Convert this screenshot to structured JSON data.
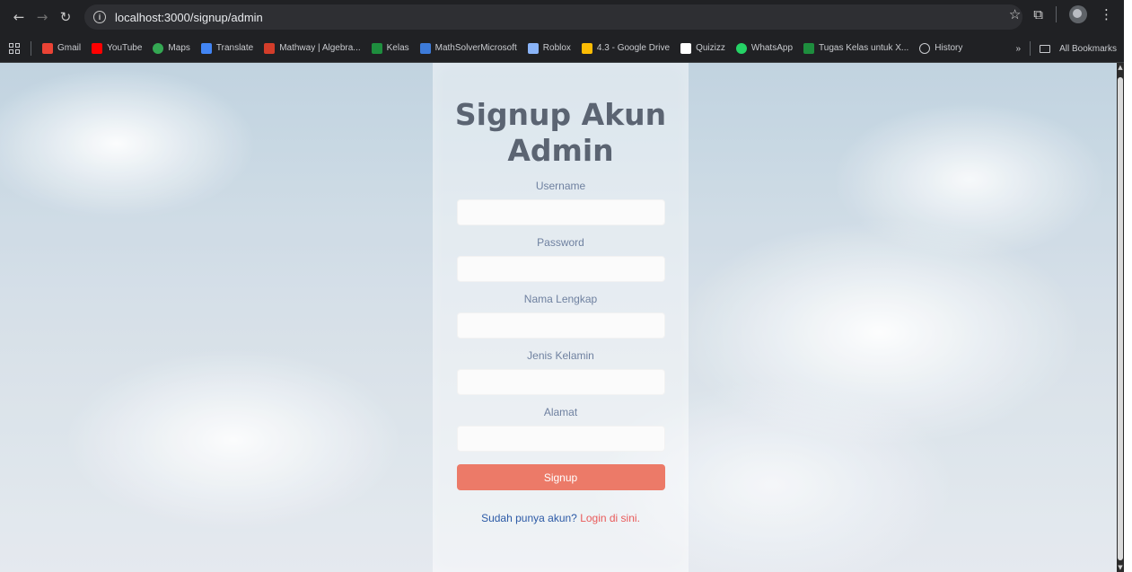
{
  "browser": {
    "url": "localhost:3000/signup/admin",
    "bookmarks": [
      {
        "label": "Gmail",
        "icon": "gmail-icon",
        "color": "#ea4335"
      },
      {
        "label": "YouTube",
        "icon": "youtube-icon",
        "color": "#ff0000"
      },
      {
        "label": "Maps",
        "icon": "maps-icon",
        "color": "#34a853"
      },
      {
        "label": "Translate",
        "icon": "translate-icon",
        "color": "#4285f4"
      },
      {
        "label": "Mathway | Algebra...",
        "icon": "mathway-icon",
        "color": "#d33d2a"
      },
      {
        "label": "Kelas",
        "icon": "kelas-icon",
        "color": "#1e8e3e"
      },
      {
        "label": "MathSolverMicrosoft",
        "icon": "math-solver-icon",
        "color": "#3d7bd9"
      },
      {
        "label": "Roblox",
        "icon": "roblox-icon",
        "color": "#8ab4f8"
      },
      {
        "label": "4.3 - Google Drive",
        "icon": "drive-icon",
        "color": "#fbbc04"
      },
      {
        "label": "Quizizz",
        "icon": "quizizz-icon",
        "color": "#ffffff"
      },
      {
        "label": "WhatsApp",
        "icon": "whatsapp-icon",
        "color": "#25d366"
      },
      {
        "label": "Tugas Kelas untuk X...",
        "icon": "classroom-icon",
        "color": "#1e8e3e"
      },
      {
        "label": "History",
        "icon": "history-icon",
        "color": "#c9cbcf"
      }
    ],
    "more_label": "»",
    "all_bookmarks": "All Bookmarks"
  },
  "page": {
    "title_line1": "Signup Akun",
    "title_line2": "Admin",
    "fields": [
      {
        "label": "Username"
      },
      {
        "label": "Password"
      },
      {
        "label": "Nama Lengkap"
      },
      {
        "label": "Jenis Kelamin"
      },
      {
        "label": "Alamat"
      }
    ],
    "signup_label": "Signup",
    "login_prompt": "Sudah punya akun?",
    "login_link": "Login di sini."
  }
}
